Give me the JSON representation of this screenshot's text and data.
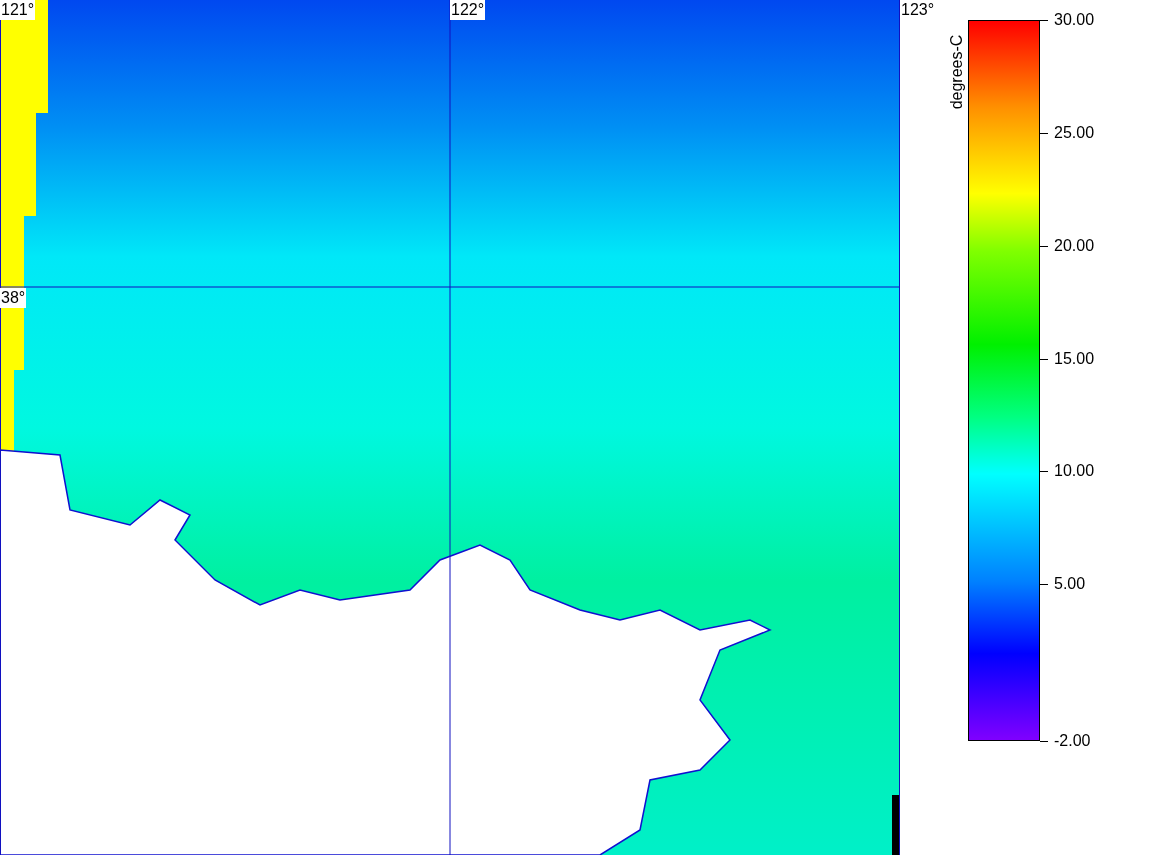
{
  "map": {
    "lon_labels": [
      "121°",
      "122°",
      "123°"
    ],
    "lat_labels": [
      "38°"
    ]
  },
  "colorbar": {
    "unit": "degrees-C",
    "ticks": [
      "30.00",
      "25.00",
      "20.00",
      "15.00",
      "10.00",
      "5.00",
      "-2.00"
    ]
  }
}
